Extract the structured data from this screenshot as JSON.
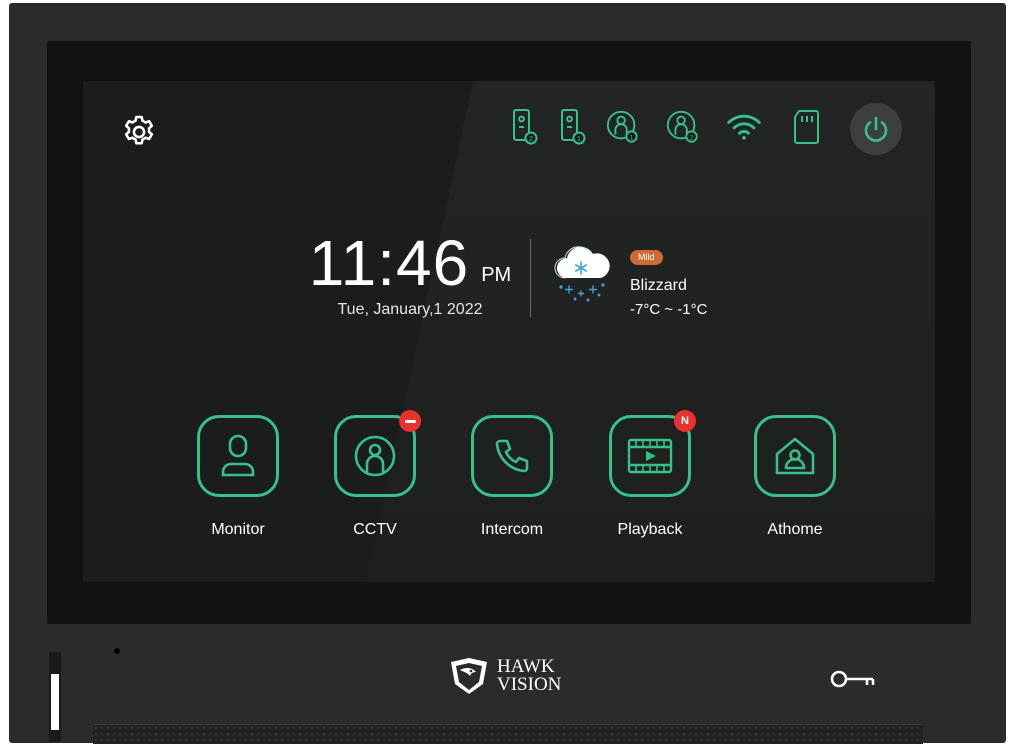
{
  "clock": {
    "time": "11:46",
    "ampm": "PM",
    "date": "Tue, January,1 2022"
  },
  "weather": {
    "badge": "Mild",
    "condition": "Blizzard",
    "range": "-7°C ~ -1°C",
    "icon": "snow-cloud-icon"
  },
  "status_icons": [
    {
      "name": "door-station-1-icon"
    },
    {
      "name": "door-station-2-icon"
    },
    {
      "name": "camera-1-icon"
    },
    {
      "name": "camera-2-icon"
    },
    {
      "name": "wifi-icon"
    },
    {
      "name": "sd-card-icon"
    },
    {
      "name": "power-icon"
    }
  ],
  "apps": [
    {
      "label": "Monitor",
      "icon": "user-icon"
    },
    {
      "label": "CCTV",
      "icon": "cctv-person-icon",
      "badge": "minus"
    },
    {
      "label": "Intercom",
      "icon": "phone-icon"
    },
    {
      "label": "Playback",
      "icon": "video-icon",
      "badge": "N"
    },
    {
      "label": "Athome",
      "icon": "home-person-icon"
    }
  ],
  "brand": {
    "line1": "HAWK",
    "line2": "VISION"
  },
  "colors": {
    "accent": "#36c08a",
    "badge": "#d06a35",
    "notify": "#e8322e"
  }
}
